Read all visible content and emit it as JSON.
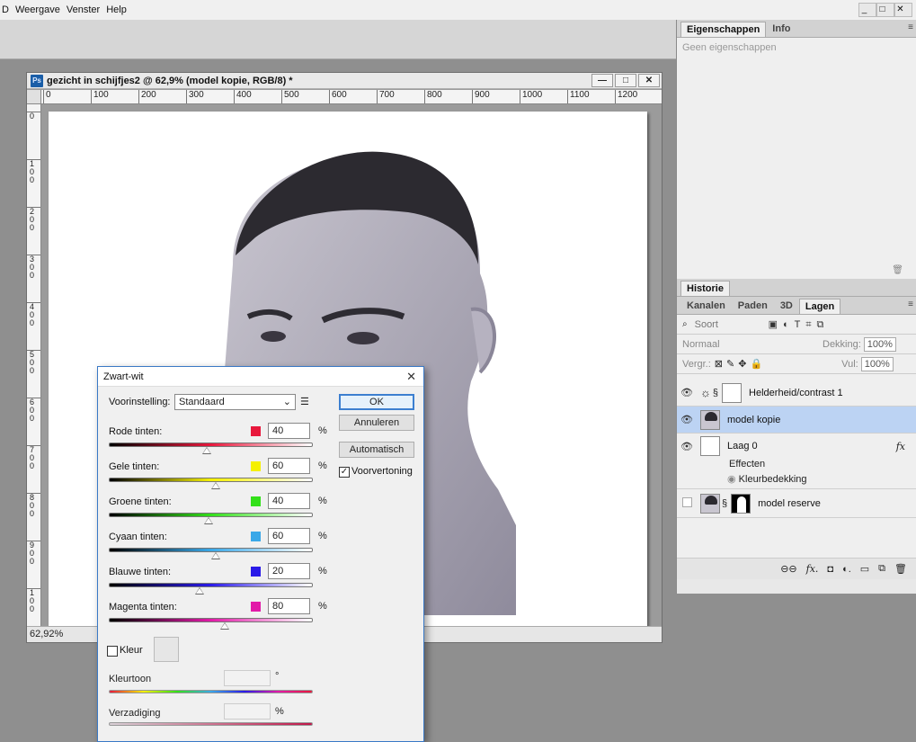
{
  "menubar": {
    "items": [
      "D",
      "Weergave",
      "Venster",
      "Help"
    ],
    "win_buttons": [
      "_",
      "□",
      "✕"
    ]
  },
  "document": {
    "title": "gezicht in schijfjes2 @ 62,9% (model kopie, RGB/8) *",
    "buttons": [
      "—",
      "□",
      "✕"
    ],
    "ruler_h": [
      "0",
      "100",
      "200",
      "300",
      "400",
      "500",
      "600",
      "700",
      "800",
      "900",
      "1000",
      "1100",
      "1200"
    ],
    "ruler_v": [
      "0",
      "1\n0\n0",
      "2\n0\n0",
      "3\n0\n0",
      "4\n0\n0",
      "5\n0\n0",
      "6\n0\n0",
      "7\n0\n0",
      "8\n0\n0",
      "9\n0\n0",
      "1\n0\n0"
    ],
    "zoom": "62,92%"
  },
  "properties_panel": {
    "tabs": [
      "Eigenschappen",
      "Info"
    ],
    "empty_text": "Geen eigenschappen"
  },
  "history_panel": {
    "tab": "Historie"
  },
  "layers_panel": {
    "tabs": [
      "Kanalen",
      "Paden",
      "3D",
      "Lagen"
    ],
    "filter": "Soort",
    "blend_mode": "Normaal",
    "opacity_label": "Dekking:",
    "opacity_value": "100%",
    "lock_label": "Vergr.:",
    "fill_label": "Vul:",
    "fill_value": "100%",
    "layers": [
      {
        "name": "Helderheid/contrast 1",
        "visible": true
      },
      {
        "name": "model kopie",
        "visible": true,
        "selected": true
      },
      {
        "name": "Laag 0",
        "visible": true,
        "fx": "fx"
      },
      {
        "name": "Effecten"
      },
      {
        "name": "Kleurbedekking"
      },
      {
        "name": "model reserve",
        "visible": false
      }
    ]
  },
  "dialog": {
    "title": "Zwart-wit",
    "preset_label": "Voorinstelling:",
    "preset_value": "Standaard",
    "buttons": {
      "ok": "OK",
      "cancel": "Annuleren",
      "auto": "Automatisch"
    },
    "preview_label": "Voorvertoning",
    "preview_checked": true,
    "sliders": [
      {
        "label": "Rode tinten:",
        "value": "40",
        "pct": 40,
        "color": "#e8183c"
      },
      {
        "label": "Gele tinten:",
        "value": "60",
        "pct": 60,
        "color": "#f5f000"
      },
      {
        "label": "Groene tinten:",
        "value": "40",
        "pct": 40,
        "color": "#33e01a"
      },
      {
        "label": "Cyaan tinten:",
        "value": "60",
        "pct": 60,
        "color": "#3aa8e8"
      },
      {
        "label": "Blauwe tinten:",
        "value": "20",
        "pct": 20,
        "color": "#2a1ae8"
      },
      {
        "label": "Magenta tinten:",
        "value": "80",
        "pct": 80,
        "color": "#e21aa8"
      }
    ],
    "percent": "%",
    "tint_label": "Kleur",
    "hue_label": "Kleurtoon",
    "hue_unit": "°",
    "sat_label": "Verzadiging",
    "sat_unit": "%"
  }
}
